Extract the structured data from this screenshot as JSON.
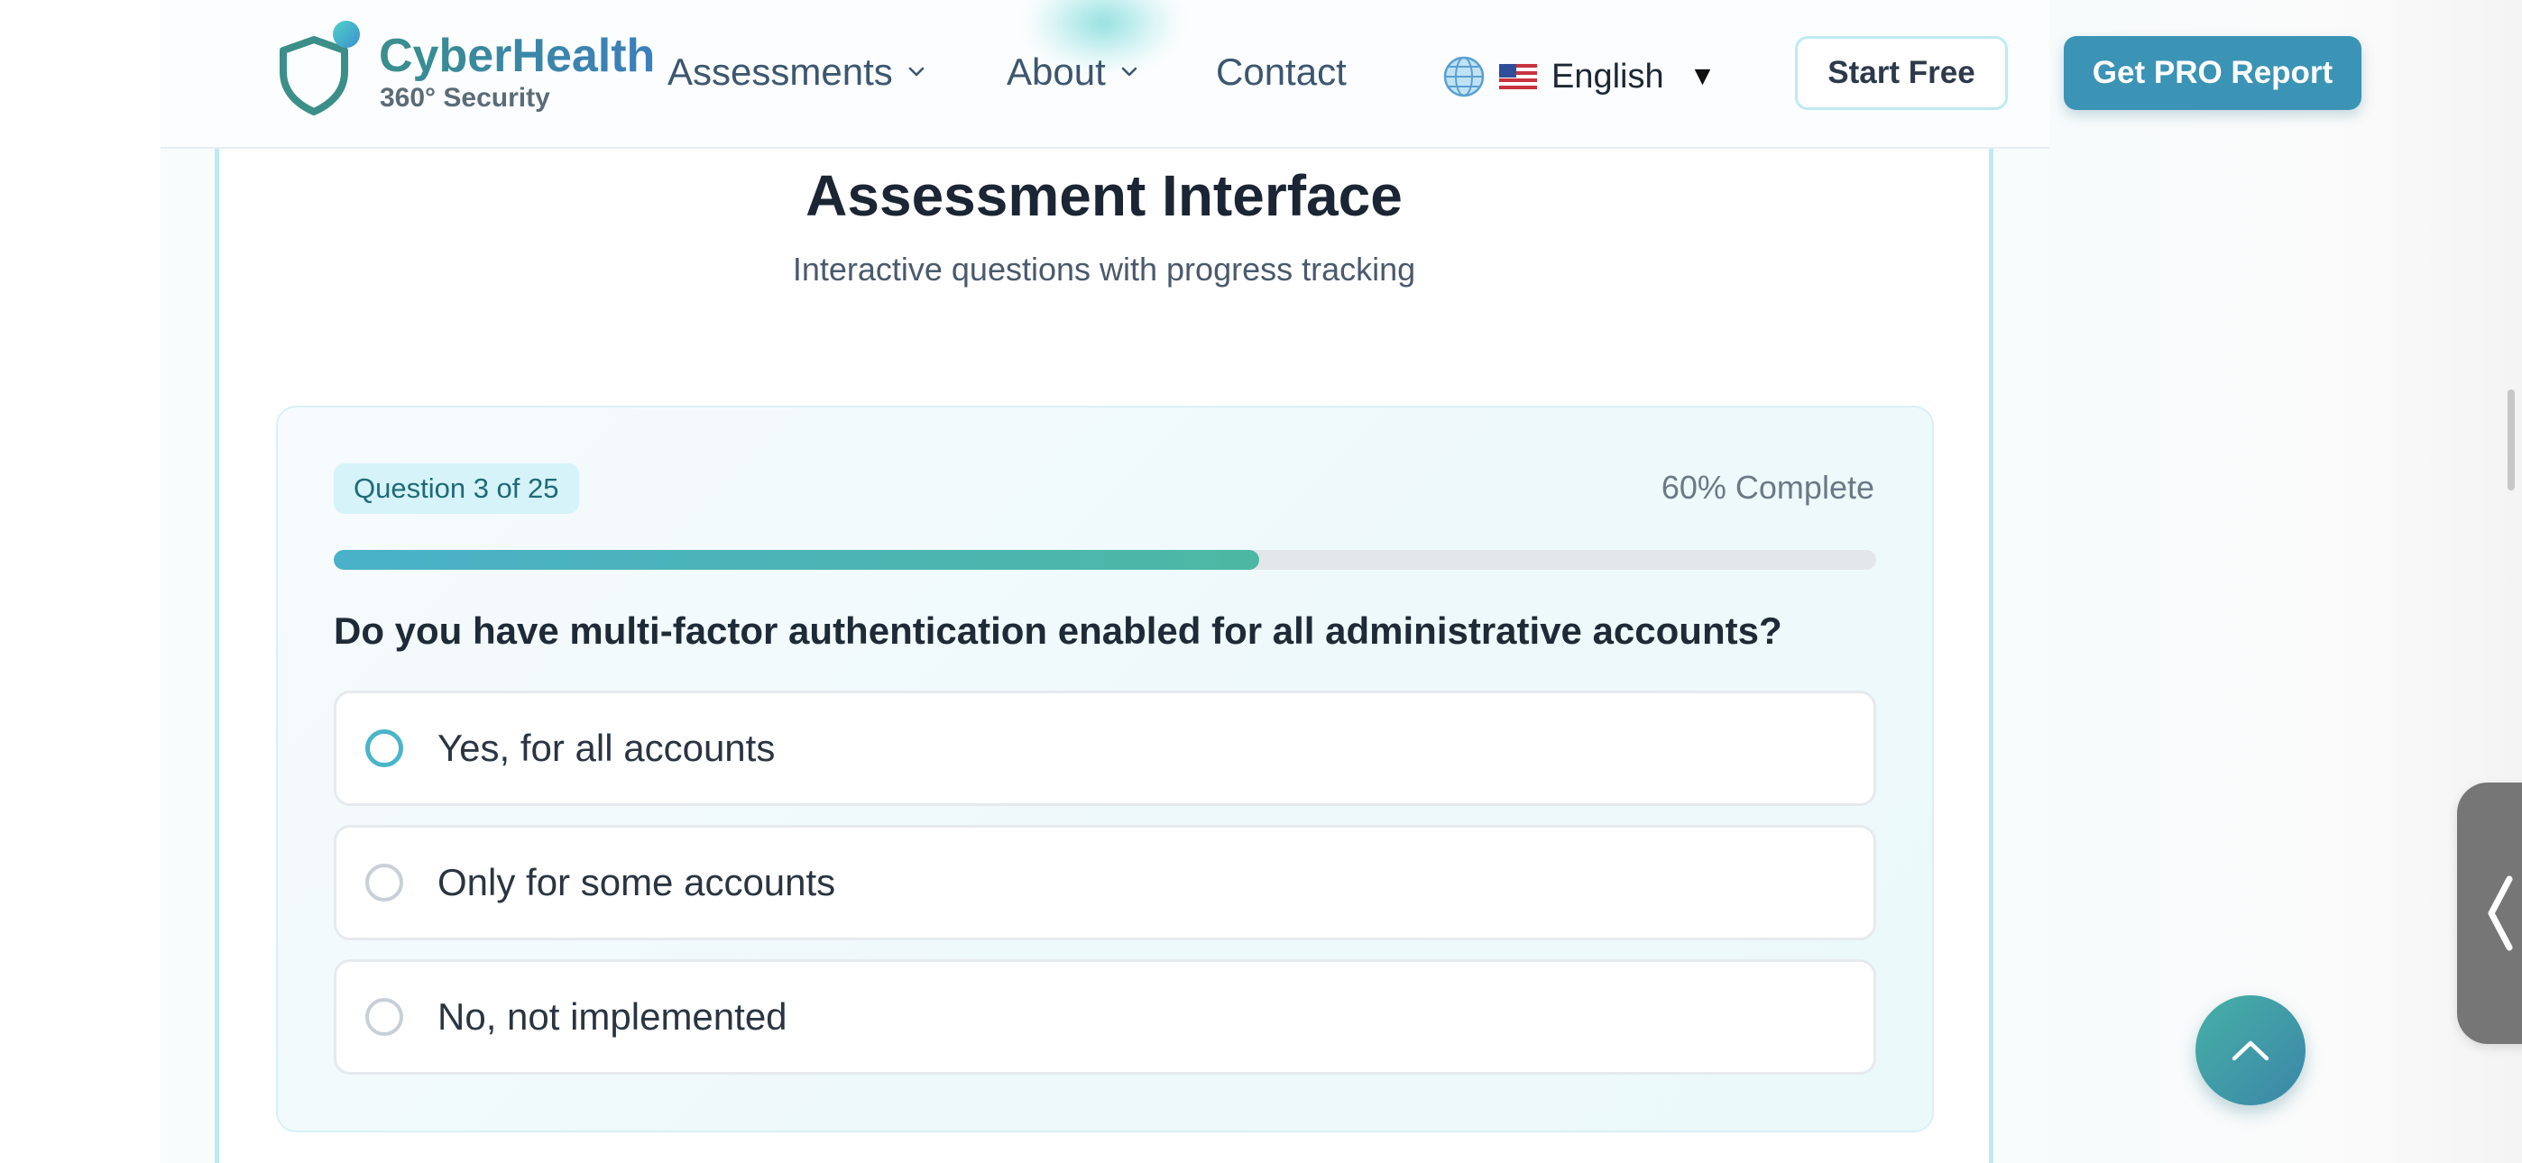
{
  "header": {
    "brand_name": "CyberHealth",
    "brand_tagline": "360° Security",
    "nav": {
      "assessments": "Assessments",
      "about": "About",
      "contact": "Contact"
    },
    "language": {
      "label": "English",
      "flag": "us-flag",
      "caret": "▼"
    },
    "start_free_label": "Start Free",
    "pro_report_label": "Get PRO Report"
  },
  "section": {
    "title": "Assessment Interface",
    "subtitle": "Interactive questions with progress tracking"
  },
  "question": {
    "counter": "Question 3 of 25",
    "progress_text": "60% Complete",
    "progress_fraction": 0.6,
    "text": "Do you have multi-factor authentication enabled for all administrative accounts?",
    "options": [
      {
        "label": "Yes, for all accounts"
      },
      {
        "label": "Only for some accounts"
      },
      {
        "label": "No, not implemented"
      }
    ]
  },
  "colors": {
    "accent": "#3b93b5",
    "progress_start": "#49b1c9",
    "progress_end": "#4cb8a3",
    "badge_bg": "#d5f3f8",
    "title_text": "#1b2533"
  },
  "icons": {
    "logo": "shield-icon",
    "nav_dropdown": "chevron-down-icon",
    "language": "globe-icon",
    "side_tab": "chevron-left-icon",
    "scroll_top": "chevron-up-icon"
  }
}
